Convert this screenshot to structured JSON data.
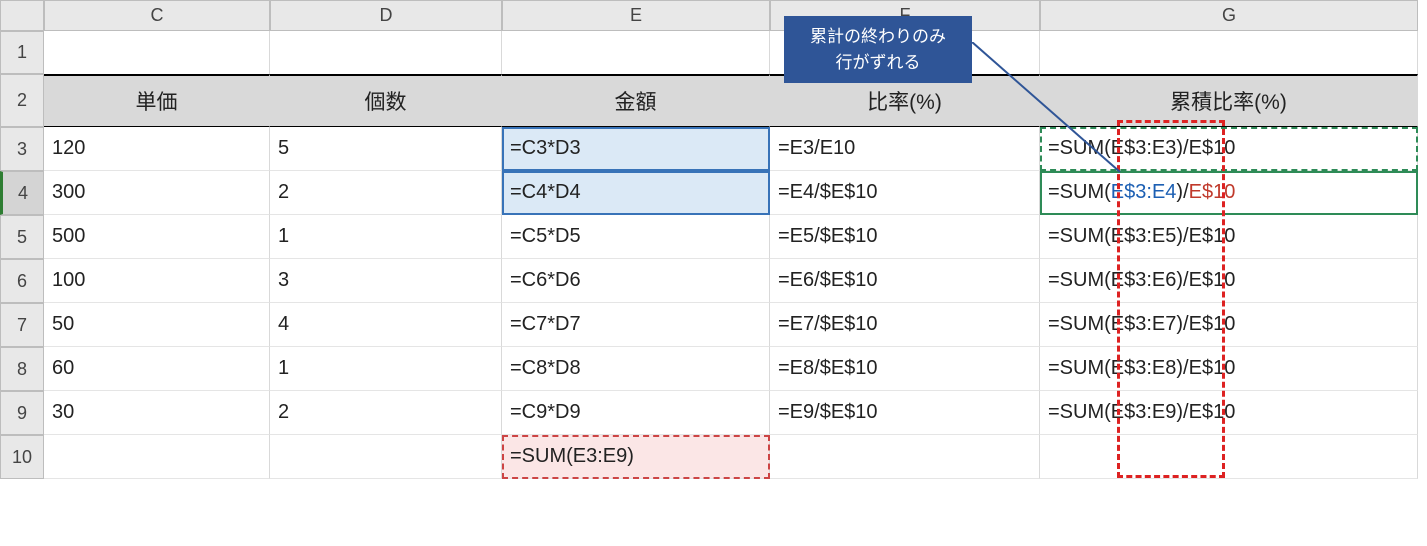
{
  "columns": [
    "C",
    "D",
    "E",
    "F",
    "G"
  ],
  "row_numbers": [
    "1",
    "2",
    "3",
    "4",
    "5",
    "6",
    "7",
    "8",
    "9",
    "10"
  ],
  "headers": {
    "C": "単価",
    "D": "個数",
    "E": "金額",
    "F": "比率(%)",
    "G": "累積比率(%)"
  },
  "rows": [
    {
      "C": "120",
      "D": "5",
      "E": "=C3*D3",
      "F": "=E3/E10",
      "G": "=SUM(E$3:E3)/E$10"
    },
    {
      "C": "300",
      "D": "2",
      "E": "=C4*D4",
      "F": "=E4/$E$10",
      "G_a": "=SUM(",
      "G_b": "E$3:E4",
      "G_c": ")/",
      "G_d": "E$10"
    },
    {
      "C": "500",
      "D": "1",
      "E": "=C5*D5",
      "F": "=E5/$E$10",
      "G": "=SUM(E$3:E5)/E$10"
    },
    {
      "C": "100",
      "D": "3",
      "E": "=C6*D6",
      "F": "=E6/$E$10",
      "G": "=SUM(E$3:E6)/E$10"
    },
    {
      "C": "50",
      "D": "4",
      "E": "=C7*D7",
      "F": "=E7/$E$10",
      "G": "=SUM(E$3:E7)/E$10"
    },
    {
      "C": "60",
      "D": "1",
      "E": "=C8*D8",
      "F": "=E8/$E$10",
      "G": "=SUM(E$3:E8)/E$10"
    },
    {
      "C": "30",
      "D": "2",
      "E": "=C9*D9",
      "F": "=E9/$E$10",
      "G": "=SUM(E$3:E9)/E$10"
    }
  ],
  "row10": {
    "E": "=SUM(E3:E9)"
  },
  "callout": {
    "line1": "累計の終わりのみ",
    "line2": "行がずれる"
  }
}
